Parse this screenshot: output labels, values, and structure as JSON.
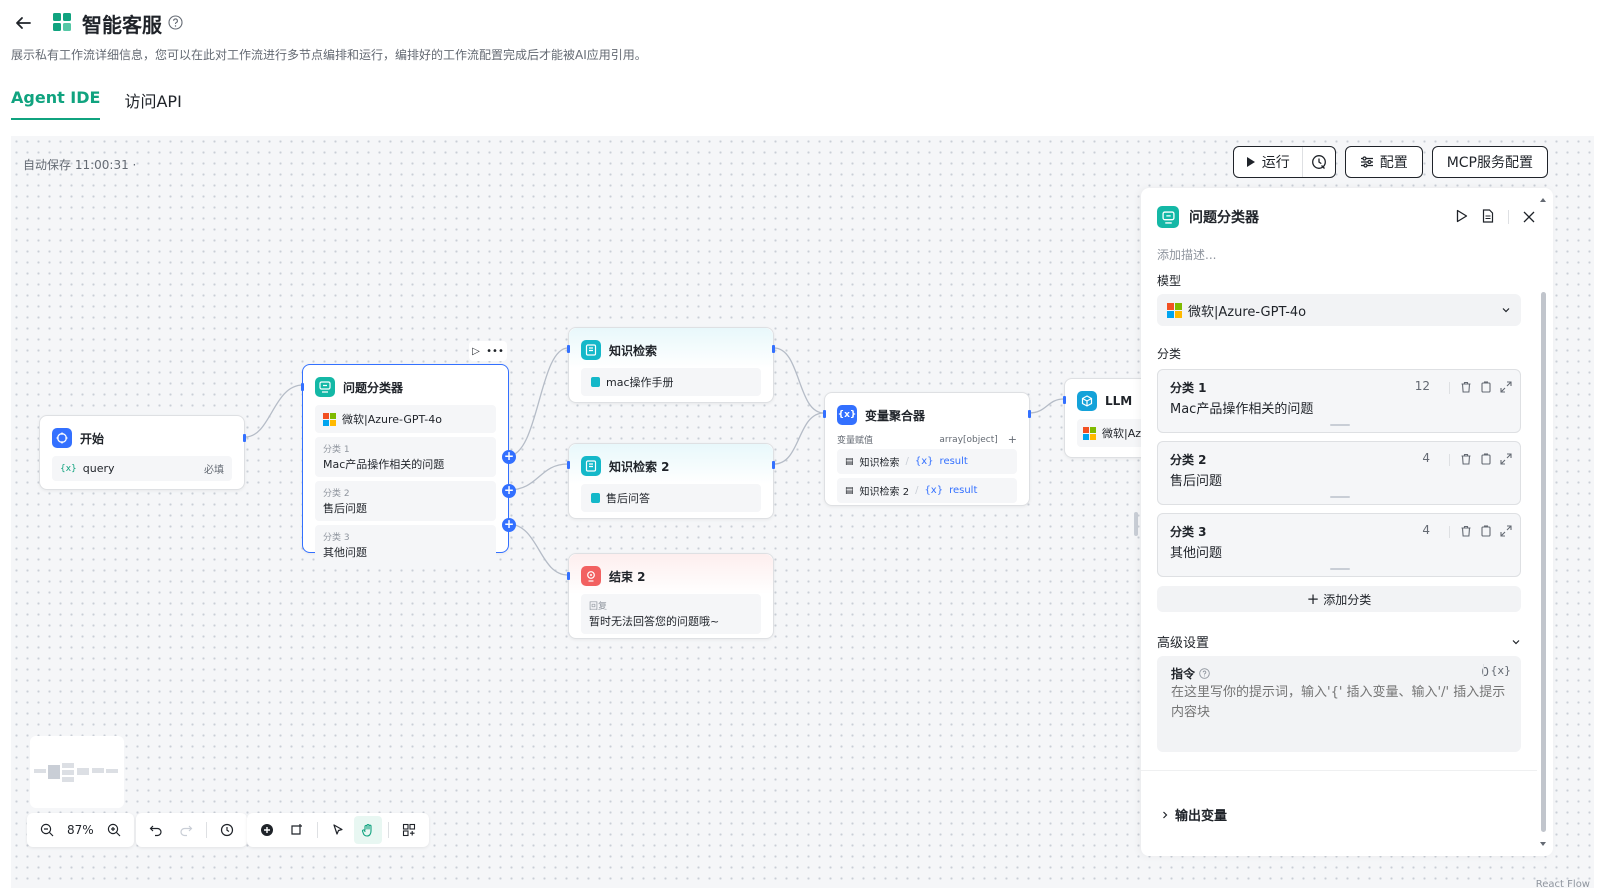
{
  "header": {
    "title": "智能客服",
    "description": "展示私有工作流详细信息，您可以在此对工作流进行多节点编排和运行，编排好的工作流配置完成后才能被AI应用引用。"
  },
  "tabs": [
    {
      "label": "Agent IDE",
      "active": true
    },
    {
      "label": "访问API",
      "active": false
    }
  ],
  "canvas": {
    "autosave": "自动保存 11:00:31 ·",
    "actions": {
      "run": "运行",
      "config": "配置",
      "mcp": "MCP服务配置"
    },
    "zoom": "87%",
    "attribution": "React Flow"
  },
  "nodes": {
    "start": {
      "title": "开始",
      "var_name": "query",
      "required": "必填"
    },
    "classifier": {
      "title": "问题分类器",
      "model": "微软|Azure-GPT-4o",
      "classes": [
        {
          "label": "分类 1",
          "text": "Mac产品操作相关的问题"
        },
        {
          "label": "分类 2",
          "text": "售后问题"
        },
        {
          "label": "分类 3",
          "text": "其他问题"
        }
      ]
    },
    "kb1": {
      "title": "知识检索",
      "kb": "mac操作手册"
    },
    "kb2": {
      "title": "知识检索 2",
      "kb": "售后问答"
    },
    "end2": {
      "title": "结束 2",
      "reply_label": "回复",
      "reply": "暂时无法回答您的问题哦~"
    },
    "aggregator": {
      "title": "变量聚合器",
      "assign_label": "变量赋值",
      "type": "array[object]",
      "vars": [
        {
          "source": "知识检索",
          "var": "result"
        },
        {
          "source": "知识检索 2",
          "var": "result"
        }
      ]
    },
    "llm": {
      "title": "LLM",
      "model": "微软|Azu"
    }
  },
  "panel": {
    "title": "问题分类器",
    "desc_placeholder": "添加描述...",
    "model_label": "模型",
    "model": "微软|Azure-GPT-4o",
    "classes_label": "分类",
    "classes": [
      {
        "label": "分类 1",
        "text": "Mac产品操作相关的问题",
        "count": "12"
      },
      {
        "label": "分类 2",
        "text": "售后问题",
        "count": "4"
      },
      {
        "label": "分类 3",
        "text": "其他问题",
        "count": "4"
      }
    ],
    "add_class": "添加分类",
    "advanced": "高级设置",
    "instruction_label": "指令",
    "instruction_count": "0",
    "instruction_var": "{x}",
    "instruction_placeholder": "在这里写你的提示词，输入'{' 插入变量、输入'/' 插入提示内容块",
    "output_vars": "输出变量"
  },
  "colors": {
    "accent": "#10a37f",
    "edge": "#b5bcc7",
    "handle": "#3370ff",
    "teal_icon": "#14b8c9",
    "blue_icon": "#3370ff",
    "red_icon": "#f26161"
  }
}
